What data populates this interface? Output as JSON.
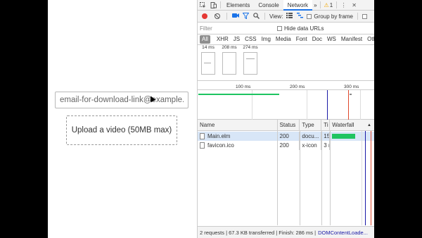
{
  "page": {
    "email_placeholder": "email-for-download-link@example.com",
    "upload_label": "Upload a video (50MB max)"
  },
  "devtools": {
    "tabs": [
      {
        "label": "Elements"
      },
      {
        "label": "Console"
      },
      {
        "label": "Network"
      }
    ],
    "more_tabs_glyph": "»",
    "warning_count": "1",
    "warning_glyph": "⚠",
    "menu_glyph": "⋮",
    "close_glyph": "✕",
    "toolbar": {
      "view_label": "View:",
      "group_by_frame_label": "Group by frame"
    },
    "filter": {
      "placeholder": "Filter",
      "hide_data_urls_label": "Hide data URLs"
    },
    "types": [
      "All",
      "XHR",
      "JS",
      "CSS",
      "Img",
      "Media",
      "Font",
      "Doc",
      "WS",
      "Manifest",
      "Other"
    ],
    "filmstrip": [
      {
        "time": "14 ms"
      },
      {
        "time": "208 ms"
      },
      {
        "time": "274 ms"
      }
    ],
    "overview_ticks": [
      "100 ms",
      "200 ms",
      "300 ms"
    ],
    "columns": {
      "name": "Name",
      "status": "Status",
      "type": "Type",
      "time": "Ti",
      "waterfall": "Waterfall",
      "sort_glyph": "▲"
    },
    "rows": [
      {
        "name": "Main.elm",
        "status": "200",
        "type": "docu...",
        "time": "15",
        "waterfall_start": 0.0,
        "waterfall_end": 0.52
      },
      {
        "name": "favicon.ico",
        "status": "200",
        "type": "x-icon",
        "time": "3 r"
      }
    ],
    "statusbar": {
      "summary": "2 requests | 67.3 KB transferred | Finish: 286 ms |",
      "dcl": "DOMContentLoade..."
    },
    "colors": {
      "accent": "#1a73e8",
      "record": "#e53935",
      "waterfall": "#1ec461",
      "dcl_line": "#1a1aa6",
      "load_line": "#e0472b"
    }
  }
}
